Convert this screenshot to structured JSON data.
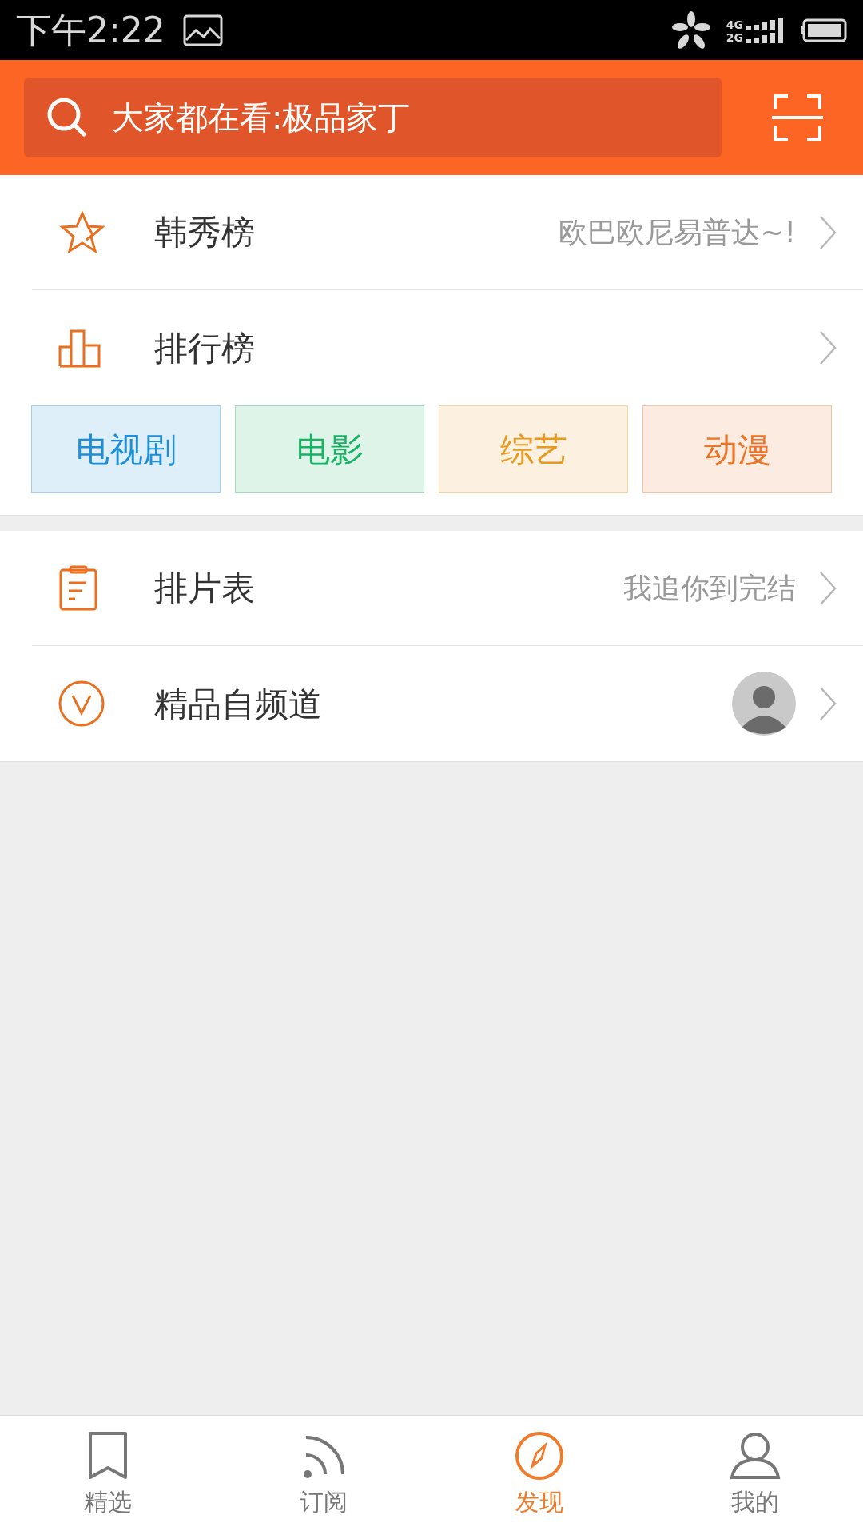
{
  "status_bar": {
    "time": "下午2:22",
    "network_top": "4G",
    "network_bottom": "2G"
  },
  "search": {
    "placeholder": "大家都在看:极品家丁"
  },
  "section_1": [
    {
      "kind": "hint",
      "title": "韩秀榜",
      "hint": "欧巴欧尼易普达~!"
    },
    {
      "kind": "plain",
      "title": "排行榜"
    }
  ],
  "categories": [
    {
      "label": "电视剧",
      "color": "#1e8fd6"
    },
    {
      "label": "电影",
      "color": "#19b264"
    },
    {
      "label": "综艺",
      "color": "#e89a20"
    },
    {
      "label": "动漫",
      "color": "#ec7425"
    }
  ],
  "section_2": [
    {
      "kind": "hint",
      "title": "排片表",
      "hint": "我追你到完结"
    },
    {
      "kind": "avatar",
      "title": "精品自频道"
    }
  ],
  "nav": [
    {
      "label": "精选",
      "selected": false
    },
    {
      "label": "订阅",
      "selected": false
    },
    {
      "label": "发现",
      "selected": true
    },
    {
      "label": "我的",
      "selected": false
    }
  ]
}
